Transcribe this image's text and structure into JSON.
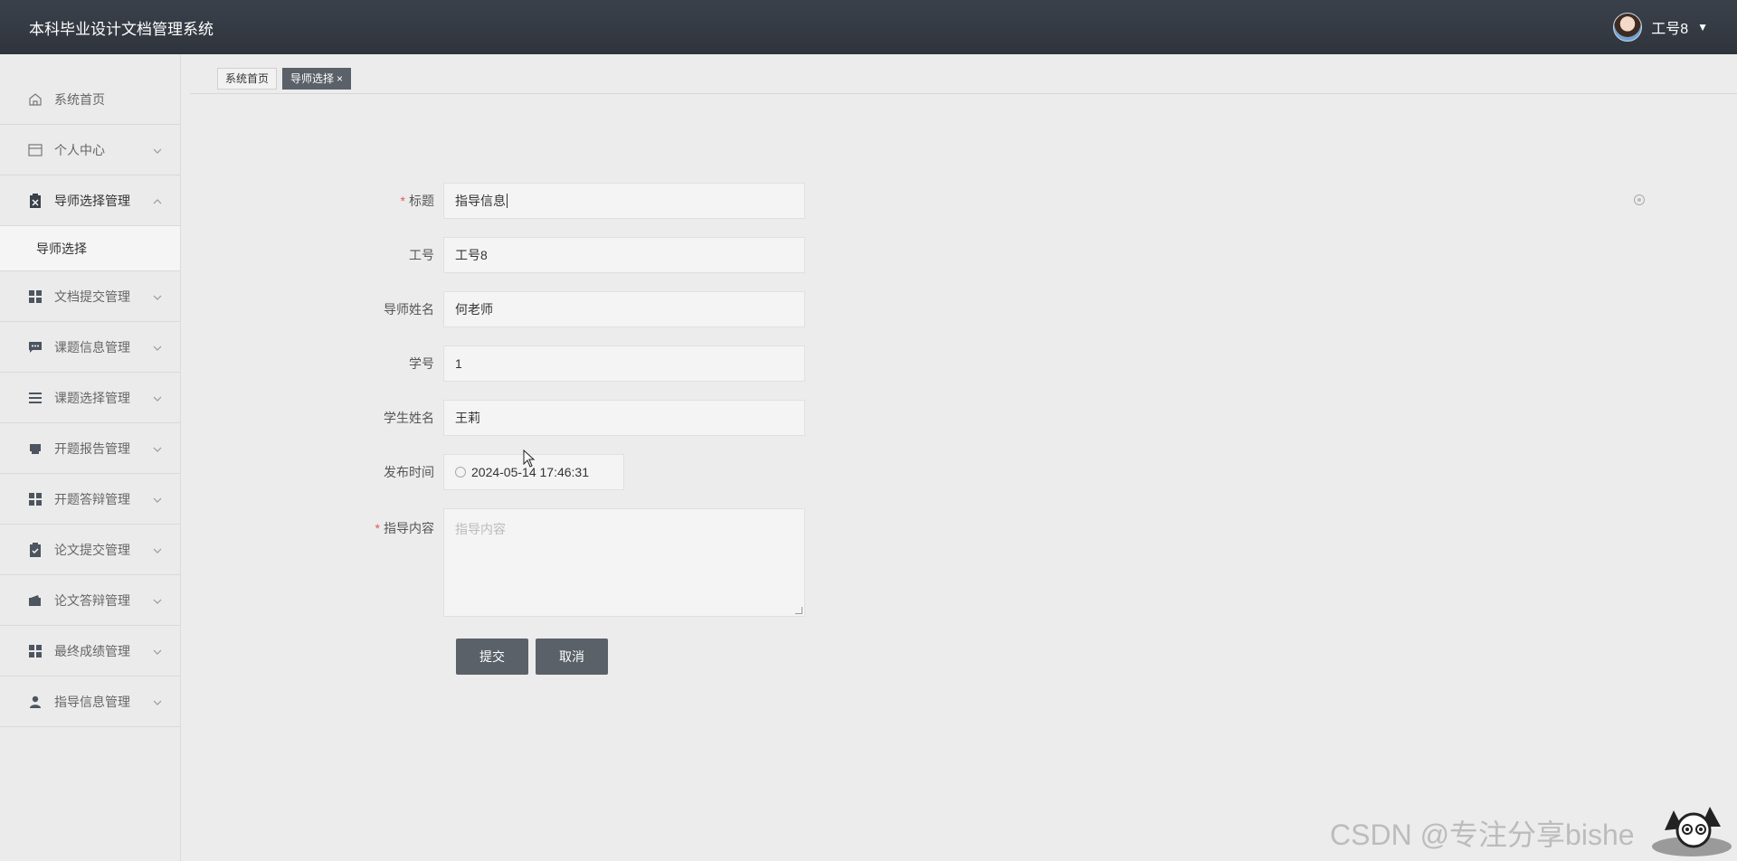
{
  "header": {
    "title": "本科毕业设计文档管理系统",
    "username": "工号8",
    "caret": "▼"
  },
  "sidebar": {
    "items": [
      {
        "label": "系统首页",
        "icon": "home-icon"
      },
      {
        "label": "个人中心",
        "icon": "card-icon"
      },
      {
        "label": "导师选择管理",
        "icon": "clipboard-icon",
        "expanded": true,
        "children": [
          {
            "label": "导师选择"
          }
        ]
      },
      {
        "label": "文档提交管理",
        "icon": "grid-icon"
      },
      {
        "label": "课题信息管理",
        "icon": "chat-icon"
      },
      {
        "label": "课题选择管理",
        "icon": "list-icon"
      },
      {
        "label": "开题报告管理",
        "icon": "printer-icon"
      },
      {
        "label": "开题答辩管理",
        "icon": "grid-icon"
      },
      {
        "label": "论文提交管理",
        "icon": "clipboard-check-icon"
      },
      {
        "label": "论文答辩管理",
        "icon": "wallet-icon"
      },
      {
        "label": "最终成绩管理",
        "icon": "grid-icon"
      },
      {
        "label": "指导信息管理",
        "icon": "user-icon"
      }
    ]
  },
  "tabs": [
    {
      "label": "系统首页",
      "active": false
    },
    {
      "label": "导师选择",
      "active": true,
      "close": "×"
    }
  ],
  "form": {
    "title": {
      "label": "标题",
      "required": true,
      "value": "指导信息"
    },
    "worker_id": {
      "label": "工号",
      "value": "工号8"
    },
    "teacher_name": {
      "label": "导师姓名",
      "value": "何老师"
    },
    "student_id": {
      "label": "学号",
      "value": "1"
    },
    "student_name": {
      "label": "学生姓名",
      "value": "王莉"
    },
    "publish_time": {
      "label": "发布时间",
      "value": "2024-05-14 17:46:31"
    },
    "content": {
      "label": "指导内容",
      "required": true,
      "placeholder": "指导内容",
      "value": ""
    },
    "required_mark": "*",
    "submit_label": "提交",
    "cancel_label": "取消"
  },
  "watermark": "CSDN @专注分享bishe",
  "colors": {
    "header_bg": "#353a43",
    "button_bg": "#5a6169",
    "required": "#e05a5a"
  }
}
